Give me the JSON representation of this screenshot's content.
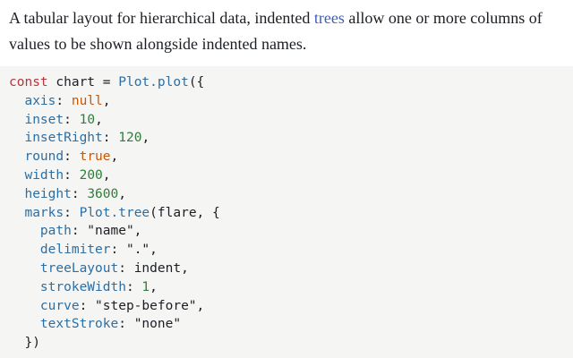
{
  "intro": {
    "before_link": "A tabular layout for hierarchical data, indented ",
    "link_text": "trees",
    "after_link": " allow one or more columns of values to be shown alongside indented names."
  },
  "code": {
    "lines": [
      [
        {
          "t": "const",
          "c": "kw"
        },
        {
          "t": " chart = ",
          "c": "str"
        },
        {
          "t": "Plot.plot",
          "c": "fn"
        },
        {
          "t": "({",
          "c": "str"
        }
      ],
      [
        {
          "t": "  ",
          "c": "str"
        },
        {
          "t": "axis",
          "c": "prop"
        },
        {
          "t": ": ",
          "c": "str"
        },
        {
          "t": "null",
          "c": "bool"
        },
        {
          "t": ",",
          "c": "str"
        }
      ],
      [
        {
          "t": "  ",
          "c": "str"
        },
        {
          "t": "inset",
          "c": "prop"
        },
        {
          "t": ": ",
          "c": "str"
        },
        {
          "t": "10",
          "c": "num"
        },
        {
          "t": ",",
          "c": "str"
        }
      ],
      [
        {
          "t": "  ",
          "c": "str"
        },
        {
          "t": "insetRight",
          "c": "prop"
        },
        {
          "t": ": ",
          "c": "str"
        },
        {
          "t": "120",
          "c": "num"
        },
        {
          "t": ",",
          "c": "str"
        }
      ],
      [
        {
          "t": "  ",
          "c": "str"
        },
        {
          "t": "round",
          "c": "prop"
        },
        {
          "t": ": ",
          "c": "str"
        },
        {
          "t": "true",
          "c": "bool"
        },
        {
          "t": ",",
          "c": "str"
        }
      ],
      [
        {
          "t": "  ",
          "c": "str"
        },
        {
          "t": "width",
          "c": "prop"
        },
        {
          "t": ": ",
          "c": "str"
        },
        {
          "t": "200",
          "c": "num"
        },
        {
          "t": ",",
          "c": "str"
        }
      ],
      [
        {
          "t": "  ",
          "c": "str"
        },
        {
          "t": "height",
          "c": "prop"
        },
        {
          "t": ": ",
          "c": "str"
        },
        {
          "t": "3600",
          "c": "num"
        },
        {
          "t": ",",
          "c": "str"
        }
      ],
      [
        {
          "t": "  ",
          "c": "str"
        },
        {
          "t": "marks",
          "c": "prop"
        },
        {
          "t": ": ",
          "c": "str"
        },
        {
          "t": "Plot.tree",
          "c": "fn"
        },
        {
          "t": "(flare, {",
          "c": "str"
        }
      ],
      [
        {
          "t": "    ",
          "c": "str"
        },
        {
          "t": "path",
          "c": "prop"
        },
        {
          "t": ": \"name\",",
          "c": "str"
        }
      ],
      [
        {
          "t": "    ",
          "c": "str"
        },
        {
          "t": "delimiter",
          "c": "prop"
        },
        {
          "t": ": \".\",",
          "c": "str"
        }
      ],
      [
        {
          "t": "    ",
          "c": "str"
        },
        {
          "t": "treeLayout",
          "c": "prop"
        },
        {
          "t": ": indent,",
          "c": "str"
        }
      ],
      [
        {
          "t": "    ",
          "c": "str"
        },
        {
          "t": "strokeWidth",
          "c": "prop"
        },
        {
          "t": ": ",
          "c": "str"
        },
        {
          "t": "1",
          "c": "num"
        },
        {
          "t": ",",
          "c": "str"
        }
      ],
      [
        {
          "t": "    ",
          "c": "str"
        },
        {
          "t": "curve",
          "c": "prop"
        },
        {
          "t": ": \"step-before\",",
          "c": "str"
        }
      ],
      [
        {
          "t": "    ",
          "c": "str"
        },
        {
          "t": "textStroke",
          "c": "prop"
        },
        {
          "t": ": \"none\"",
          "c": "str"
        }
      ],
      [
        {
          "t": "  })",
          "c": "str"
        }
      ]
    ]
  }
}
